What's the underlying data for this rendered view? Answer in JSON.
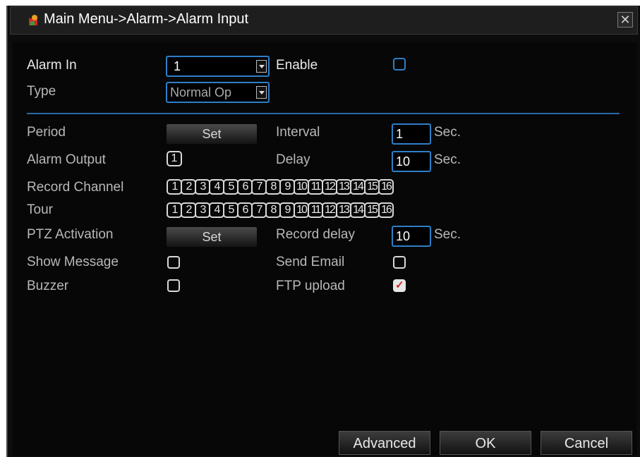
{
  "window": {
    "title": "Main Menu->Alarm->Alarm Input",
    "close_label": "✕"
  },
  "form": {
    "alarm_in_label": "Alarm In",
    "alarm_in_value": "1",
    "enable_label": "Enable",
    "type_label": "Type",
    "type_value": "Normal Op",
    "period_label": "Period",
    "set_label": "Set",
    "interval_label": "Interval",
    "interval_value": "1",
    "sec_label": "Sec.",
    "alarm_output_label": "Alarm Output",
    "alarm_output_value": "1",
    "delay_label": "Delay",
    "delay_value": "10",
    "record_channel_label": "Record Channel",
    "tour_label": "Tour",
    "channels": [
      "1",
      "2",
      "3",
      "4",
      "5",
      "6",
      "7",
      "8",
      "9",
      "10",
      "11",
      "12",
      "13",
      "14",
      "15",
      "16"
    ],
    "ptz_label": "PTZ Activation",
    "record_delay_label": "Record delay",
    "record_delay_value": "10",
    "show_message_label": "Show Message",
    "send_email_label": "Send Email",
    "buzzer_label": "Buzzer",
    "ftp_label": "FTP upload"
  },
  "buttons": {
    "advanced": "Advanced",
    "ok": "OK",
    "cancel": "Cancel"
  }
}
